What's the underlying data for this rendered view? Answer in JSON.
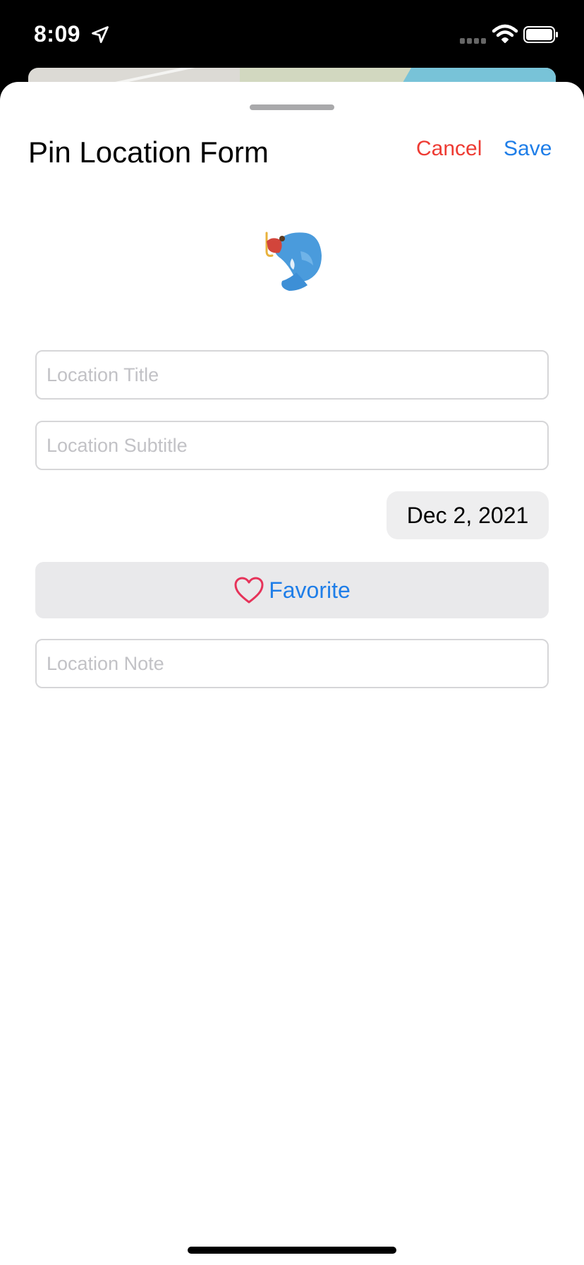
{
  "status_bar": {
    "time": "8:09"
  },
  "sheet": {
    "title": "Pin Location Form",
    "cancel_label": "Cancel",
    "save_label": "Save"
  },
  "form": {
    "title_placeholder": "Location Title",
    "subtitle_placeholder": "Location Subtitle",
    "date": "Dec 2, 2021",
    "favorite_label": "Favorite",
    "note_placeholder": "Location Note"
  },
  "icons": {
    "location_arrow": "location-arrow-icon",
    "wifi": "wifi-icon",
    "battery": "battery-icon",
    "fish": "fish-icon",
    "heart": "heart-outline-icon"
  },
  "colors": {
    "cancel": "#ee3b33",
    "accent": "#1f7ee8",
    "heart": "#e6335a"
  }
}
